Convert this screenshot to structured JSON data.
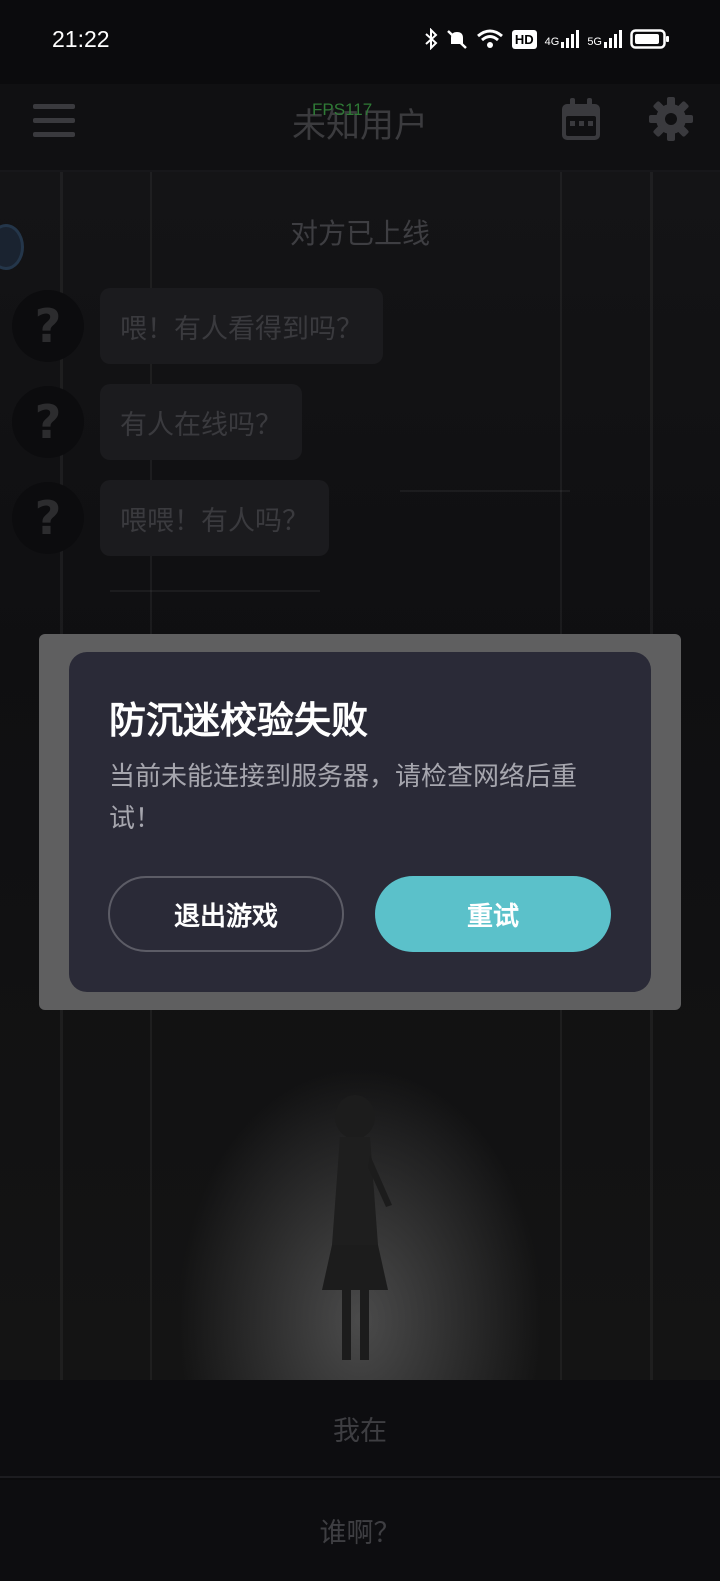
{
  "status_bar": {
    "time": "21:22",
    "icons": [
      "bluetooth-icon",
      "mute-icon",
      "wifi-icon",
      "hd-icon",
      "signal-4g-icon",
      "signal-5g-icon",
      "battery-icon"
    ],
    "network_labels": [
      "HD",
      "4G",
      "5G"
    ]
  },
  "header": {
    "title": "未知用户",
    "fps": "FPS117"
  },
  "chat": {
    "status": "对方已上线",
    "messages": [
      {
        "avatar": "?",
        "text": "喂！有人看得到吗？"
      },
      {
        "avatar": "?",
        "text": "有人在线吗？"
      },
      {
        "avatar": "?",
        "text": "喂喂！有人吗？"
      }
    ]
  },
  "dialog": {
    "title": "防沉迷校验失败",
    "message": "当前未能连接到服务器，请检查网络后重试！",
    "exit_label": "退出游戏",
    "retry_label": "重试"
  },
  "replies": {
    "option_1": "我在",
    "option_2": "谁啊？"
  },
  "colors": {
    "dialog_bg": "#2a2a37",
    "retry_button": "#5bc1ca",
    "fps_text": "#2f7a36"
  }
}
